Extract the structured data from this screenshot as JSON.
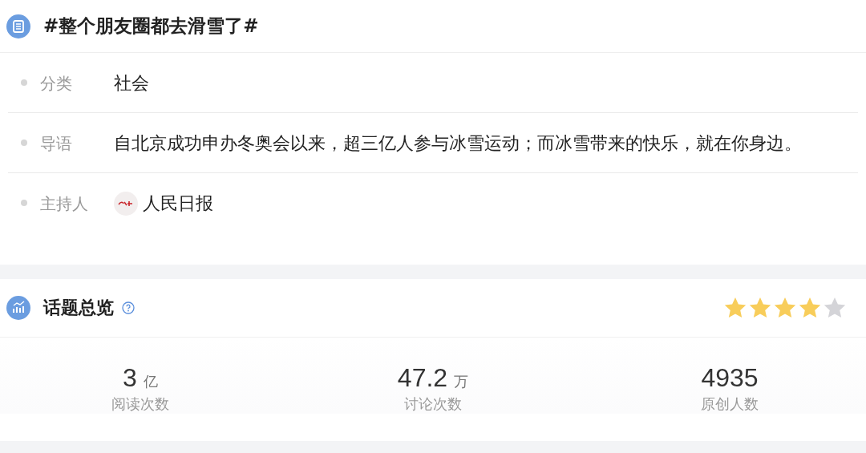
{
  "topic": {
    "title": "#整个朋友圈都去滑雪了#",
    "fields": [
      {
        "kind": "text",
        "label": "分类",
        "value": "社会"
      },
      {
        "kind": "text",
        "label": "导语",
        "value": "自北京成功申办冬奥会以来，超三亿人参与冰雪运动；而冰雪带来的快乐，就在你身边。"
      },
      {
        "kind": "host",
        "label": "主持人",
        "value": "人民日报"
      }
    ]
  },
  "overview": {
    "title": "话题总览",
    "stars": 4,
    "stats": [
      {
        "value": "3",
        "unit": "亿",
        "label": "阅读次数"
      },
      {
        "value": "47.2",
        "unit": "万",
        "label": "讨论次数"
      },
      {
        "value": "4935",
        "label": "原创人数"
      }
    ]
  }
}
